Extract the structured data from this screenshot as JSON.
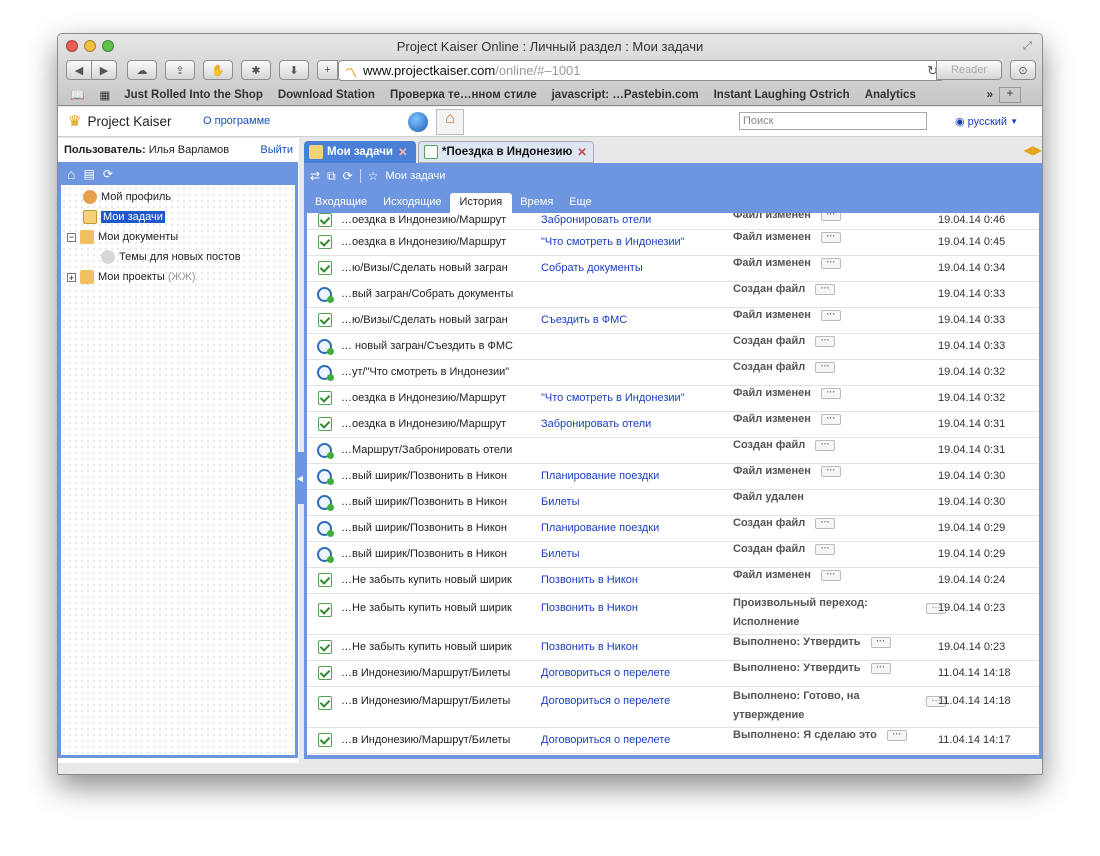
{
  "window": {
    "title": "Project Kaiser Online : Личный раздел : Мои задачи"
  },
  "browser": {
    "url_host": "www.projectkaiser.com",
    "url_path": "/online/#–1001",
    "reader_label": "Reader",
    "bookmarks": [
      "Just Rolled Into the Shop",
      "Download Station",
      "Проверка те…нном стиле",
      "javascript: …Pastebin.com",
      "Instant Laughing Ostrich",
      "Analytics"
    ]
  },
  "app": {
    "name": "Project Kaiser",
    "about_label": "О программе",
    "search_placeholder": "Поиск",
    "language": "русский"
  },
  "user": {
    "label": "Пользователь:",
    "name": "Илья Варламов",
    "logout": "Выйти"
  },
  "sidebar": {
    "items": [
      {
        "label": "Мой профиль",
        "icon": "user-icon"
      },
      {
        "label": "Мои задачи",
        "icon": "tasks-icon"
      },
      {
        "label": "Мои документы",
        "icon": "folder-icon"
      },
      {
        "label": "Темы для новых постов",
        "icon": "topic-icon"
      },
      {
        "label": "Мои проекты",
        "extra": "(ЖЖ)",
        "icon": "folder-icon"
      }
    ]
  },
  "tabs": [
    {
      "label": "Мои задачи"
    },
    {
      "label": "*Поездка в Индонезию"
    }
  ],
  "toolbar": {
    "favorite_label": "Мои задачи"
  },
  "subtabs": [
    "Входящие",
    "Исходящие",
    "История",
    "Время",
    "Еще"
  ],
  "history": [
    {
      "type": "task",
      "context": "…оездка в Индонезию/Маршрут",
      "link": "Забронировать отели",
      "action": "Файл изменен",
      "more": true,
      "date": "19.04.14 0:46"
    },
    {
      "type": "task",
      "context": "…оездка в Индонезию/Маршрут",
      "link": "\"Что смотреть в Индонезии\"",
      "action": "Файл изменен",
      "more": true,
      "date": "19.04.14 0:45"
    },
    {
      "type": "task",
      "context": "…ю/Визы/Сделать новый загран",
      "link": "Собрать документы",
      "action": "Файл изменен",
      "more": true,
      "date": "19.04.14 0:34"
    },
    {
      "type": "clock",
      "context": "…вый загран/Собрать документы",
      "link": "",
      "action": "Создан файл",
      "more": true,
      "date": "19.04.14 0:33"
    },
    {
      "type": "task",
      "context": "…ю/Визы/Сделать новый загран",
      "link": "Съездить в ФМС",
      "action": "Файл изменен",
      "more": true,
      "date": "19.04.14 0:33"
    },
    {
      "type": "clock",
      "context": "… новый загран/Съездить в ФМС",
      "link": "",
      "action": "Создан файл",
      "more": true,
      "date": "19.04.14 0:33"
    },
    {
      "type": "clock",
      "context": "…ут/\"Что смотреть в Индонезии\"",
      "link": "",
      "action": "Создан файл",
      "more": true,
      "date": "19.04.14 0:32"
    },
    {
      "type": "task",
      "context": "…оездка в Индонезию/Маршрут",
      "link": "\"Что смотреть в Индонезии\"",
      "action": "Файл изменен",
      "more": true,
      "date": "19.04.14 0:32"
    },
    {
      "type": "task",
      "context": "…оездка в Индонезию/Маршрут",
      "link": "Забронировать отели",
      "action": "Файл изменен",
      "more": true,
      "date": "19.04.14 0:31"
    },
    {
      "type": "clock",
      "context": "…Маршрут/Забронировать отели",
      "link": "",
      "action": "Создан файл",
      "more": true,
      "date": "19.04.14 0:31"
    },
    {
      "type": "clock",
      "context": "…вый ширик/Позвонить в Никон",
      "link": "Планирование поездки",
      "action": "Файл изменен",
      "more": true,
      "date": "19.04.14 0:30"
    },
    {
      "type": "clock",
      "context": "…вый ширик/Позвонить в Никон",
      "link": "Билеты",
      "action": "Файл удален",
      "more": false,
      "date": "19.04.14 0:30"
    },
    {
      "type": "clock",
      "context": "…вый ширик/Позвонить в Никон",
      "link": "Планирование поездки",
      "action": "Создан файл",
      "more": true,
      "date": "19.04.14 0:29"
    },
    {
      "type": "clock",
      "context": "…вый ширик/Позвонить в Никон",
      "link": "Билеты",
      "action": "Создан файл",
      "more": true,
      "date": "19.04.14 0:29"
    },
    {
      "type": "task",
      "context": "…Не забыть купить новый ширик",
      "link": "Позвонить в Никон",
      "action": "Файл изменен",
      "more": true,
      "date": "19.04.14 0:24"
    },
    {
      "type": "task",
      "context": "…Не забыть купить новый ширик",
      "link": "Позвонить в Никон",
      "action": "Произвольный переход:",
      "action2": "Исполнение",
      "more": true,
      "date": "19.04.14 0:23"
    },
    {
      "type": "task",
      "context": "…Не забыть купить новый ширик",
      "link": "Позвонить в Никон",
      "action": "Выполнено: Утвердить",
      "more": true,
      "date": "19.04.14 0:23"
    },
    {
      "type": "task",
      "context": "…в Индонезию/Маршрут/Билеты",
      "link": "Договориться о перелете",
      "action": "Выполнено: Утвердить",
      "more": true,
      "date": "11.04.14 14:18"
    },
    {
      "type": "task",
      "context": "…в Индонезию/Маршрут/Билеты",
      "link": "Договориться о перелете",
      "action": "Выполнено: Готово, на",
      "action2": "утверждение",
      "more": true,
      "date": "11.04.14 14:18"
    },
    {
      "type": "task",
      "context": "…в Индонезию/Маршрут/Билеты",
      "link": "Договориться о перелете",
      "action": "Выполнено: Я сделаю это",
      "more": true,
      "date": "11.04.14 14:17"
    }
  ],
  "colors": {
    "accent": "#6e96e0",
    "selection": "#1f58c8",
    "link": "#1a3fbe",
    "tab_active": "#4a7fd6"
  }
}
